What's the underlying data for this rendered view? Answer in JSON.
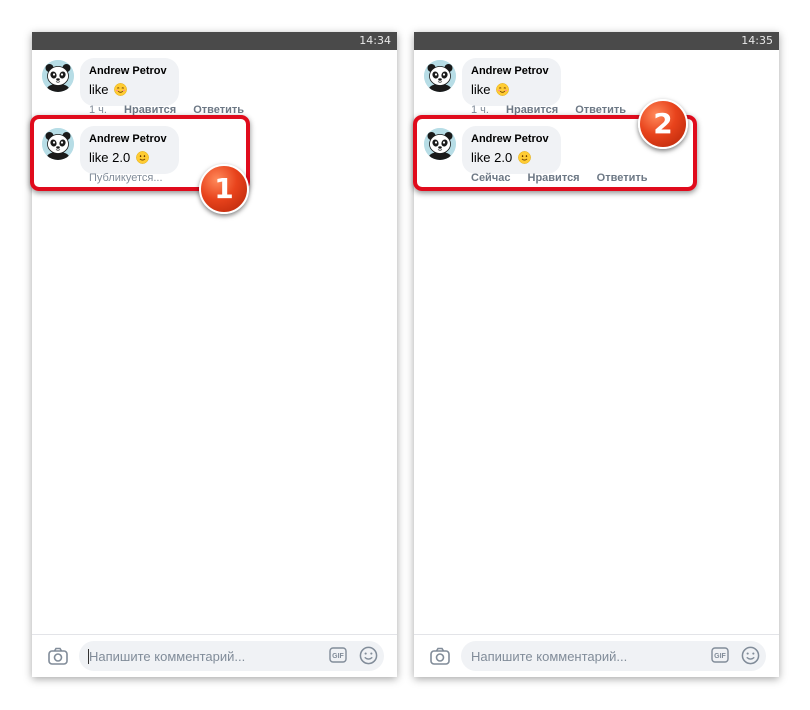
{
  "screens": [
    {
      "time": "14:34",
      "comments": [
        {
          "author": "Andrew Petrov",
          "text": "like",
          "emoji": "smiling-face-with-smiling-eyes-emoji",
          "meta": {
            "time": "1 ч.",
            "like": "Нравится",
            "reply": "Ответить"
          }
        },
        {
          "author": "Andrew Petrov",
          "text": "like 2.0",
          "emoji": "slightly-smiling-face-emoji",
          "meta": {
            "status": "Публикуется..."
          }
        }
      ],
      "input": {
        "placeholder": "Напишите комментарий..."
      },
      "callout": "1"
    },
    {
      "time": "14:35",
      "comments": [
        {
          "author": "Andrew Petrov",
          "text": "like",
          "emoji": "smiling-face-with-smiling-eyes-emoji",
          "meta": {
            "time": "1 ч.",
            "like": "Нравится",
            "reply": "Ответить"
          }
        },
        {
          "author": "Andrew Petrov",
          "text": "like 2.0",
          "emoji": "slightly-smiling-face-emoji",
          "meta": {
            "time": "Сейчас",
            "like": "Нравится",
            "reply": "Ответить"
          }
        }
      ],
      "input": {
        "placeholder": "Напишите комментарий..."
      },
      "callout": "2"
    }
  ],
  "colors": {
    "highlight": "#e00b1c",
    "badge": "#e8431c",
    "bubble": "#f0f2f5",
    "statusbar": "#4a4a4a"
  }
}
